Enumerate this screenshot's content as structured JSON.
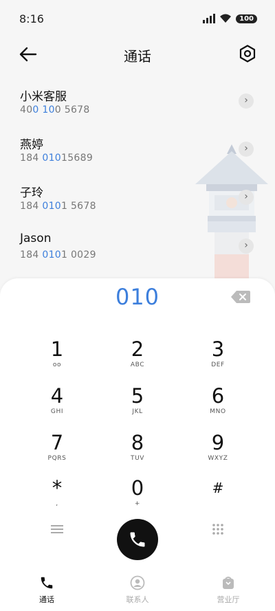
{
  "status_bar": {
    "time": "8:16",
    "battery": "100"
  },
  "header": {
    "title": "通话"
  },
  "contacts": [
    {
      "name": "小米客服",
      "number_pre": "40",
      "number_hl": "0 10",
      "number_post": "0 5678"
    },
    {
      "name": "燕婷",
      "number_pre": "184 ",
      "number_hl": "010",
      "number_post": "15689"
    },
    {
      "name": "子玲",
      "number_pre": "184 ",
      "number_hl": "010",
      "number_post": "1 5678"
    },
    {
      "name": "Jason",
      "number_pre": "184 ",
      "number_hl": "010",
      "number_post": "1 0029"
    }
  ],
  "dialpad": {
    "input": "010",
    "keys": [
      {
        "digit": "1",
        "letters": "ᴏᴏ"
      },
      {
        "digit": "2",
        "letters": "ABC"
      },
      {
        "digit": "3",
        "letters": "DEF"
      },
      {
        "digit": "4",
        "letters": "GHI"
      },
      {
        "digit": "5",
        "letters": "JKL"
      },
      {
        "digit": "6",
        "letters": "MNO"
      },
      {
        "digit": "7",
        "letters": "PQRS"
      },
      {
        "digit": "8",
        "letters": "TUV"
      },
      {
        "digit": "9",
        "letters": "WXYZ"
      },
      {
        "digit": "*",
        "letters": ","
      },
      {
        "digit": "0",
        "letters": "+"
      },
      {
        "digit": "#",
        "letters": ""
      }
    ]
  },
  "bottom_nav": [
    {
      "label": "通话",
      "icon": "phone-icon"
    },
    {
      "label": "联系人",
      "icon": "contacts-icon"
    },
    {
      "label": "营业厅",
      "icon": "store-icon"
    }
  ],
  "colors": {
    "accent": "#3d7fdc",
    "call_button": "#111111"
  }
}
